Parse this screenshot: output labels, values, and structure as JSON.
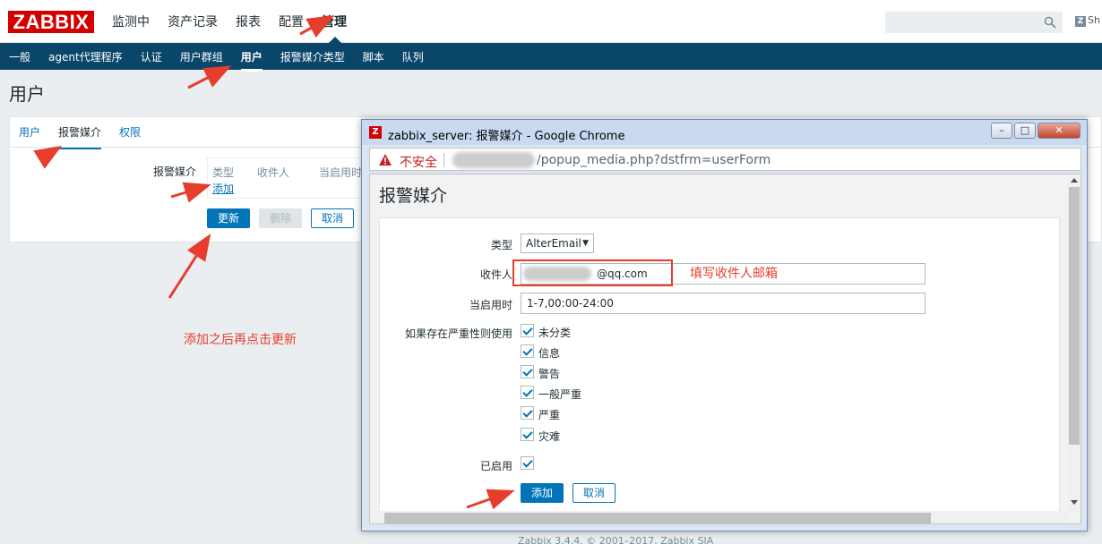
{
  "header": {
    "logo": "ZABBIX",
    "menu": [
      "监测中",
      "资产记录",
      "报表",
      "配置",
      "管理"
    ],
    "active_menu": "管理",
    "share_label": "Sh",
    "share_icon": "Z"
  },
  "submenu": [
    "一般",
    "agent代理程序",
    "认证",
    "用户群组",
    "用户",
    "报警媒介类型",
    "脚本",
    "队列"
  ],
  "page_title": "用户",
  "user_form": {
    "tabs": [
      "用户",
      "报警媒介",
      "权限"
    ],
    "media_label": "报警媒介",
    "media_columns": [
      "类型",
      "收件人",
      "当启用时"
    ],
    "add_link": "添加",
    "update_button": "更新",
    "delete_button": "删除",
    "cancel_button": "取消"
  },
  "popup": {
    "window_title": "zabbix_server: 报警媒介 - Google Chrome",
    "z_icon": "Z",
    "insecure_label": "不安全",
    "url": "/popup_media.php?dstfrm=userForm",
    "heading": "报警媒介",
    "type_label": "类型",
    "type_value": "AlterEmail",
    "recipient_label": "收件人",
    "recipient_value": "@qq.com",
    "when_active_label": "当启用时",
    "when_active_value": "1-7,00:00-24:00",
    "severity_label": "如果存在严重性则使用",
    "severities": [
      "未分类",
      "信息",
      "警告",
      "一般严重",
      "严重",
      "灾难"
    ],
    "enabled_label": "已启用",
    "add_button": "添加",
    "cancel_button": "取消"
  },
  "annotations": {
    "fill_recipient": "填写收件人邮箱",
    "add_then_update": "添加之后再点击更新",
    "color": "#e63d2d"
  },
  "footer": "Zabbix 3.4.4. © 2001–2017, Zabbix SIA"
}
